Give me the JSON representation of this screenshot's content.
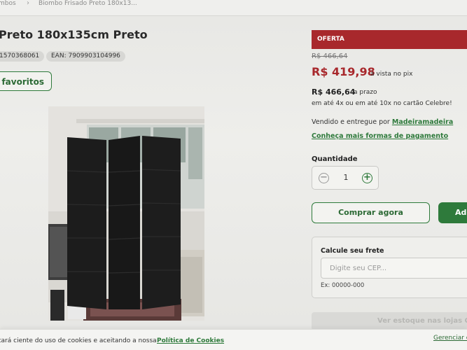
{
  "breadcrumb": {
    "prev": "mbos",
    "separator": "›",
    "current": "Biombo Frisado Preto 180x13..."
  },
  "product": {
    "title": "Preto 180x135cm Preto",
    "code": "1570368061",
    "ean": "EAN: 7909903104996",
    "favorite_label": "e favoritos"
  },
  "pricing": {
    "badge": "OFERTA",
    "old_price": "R$ 466,64",
    "pix_price": "R$ 419,98",
    "pix_note": "à vista no pix",
    "prazo_price": "R$ 466,64",
    "prazo_note": "a prazo",
    "installments": "em até 4x ou em até 10x no cartão Celebre!"
  },
  "seller": {
    "prefix": "Vendido e entregue por",
    "name": "Madeiramadeira",
    "payment_link": "Conheça mais formas de pagamento"
  },
  "quantity": {
    "label": "Quantidade",
    "value": "1",
    "minus": "−",
    "plus": "+"
  },
  "actions": {
    "buy_now": "Comprar agora",
    "add_to_cart": "Adi"
  },
  "shipping": {
    "title": "Calcule seu frete",
    "placeholder": "Digite seu CEP...",
    "example": "Ex: 00000-000",
    "stock_button": "Ver estoque nas lojas Ge"
  },
  "cookies": {
    "text": "tará ciente do uso de cookies e aceitando a nossa",
    "policy_link": "Política de Cookies",
    "manage_link": "Gerenciar c"
  }
}
